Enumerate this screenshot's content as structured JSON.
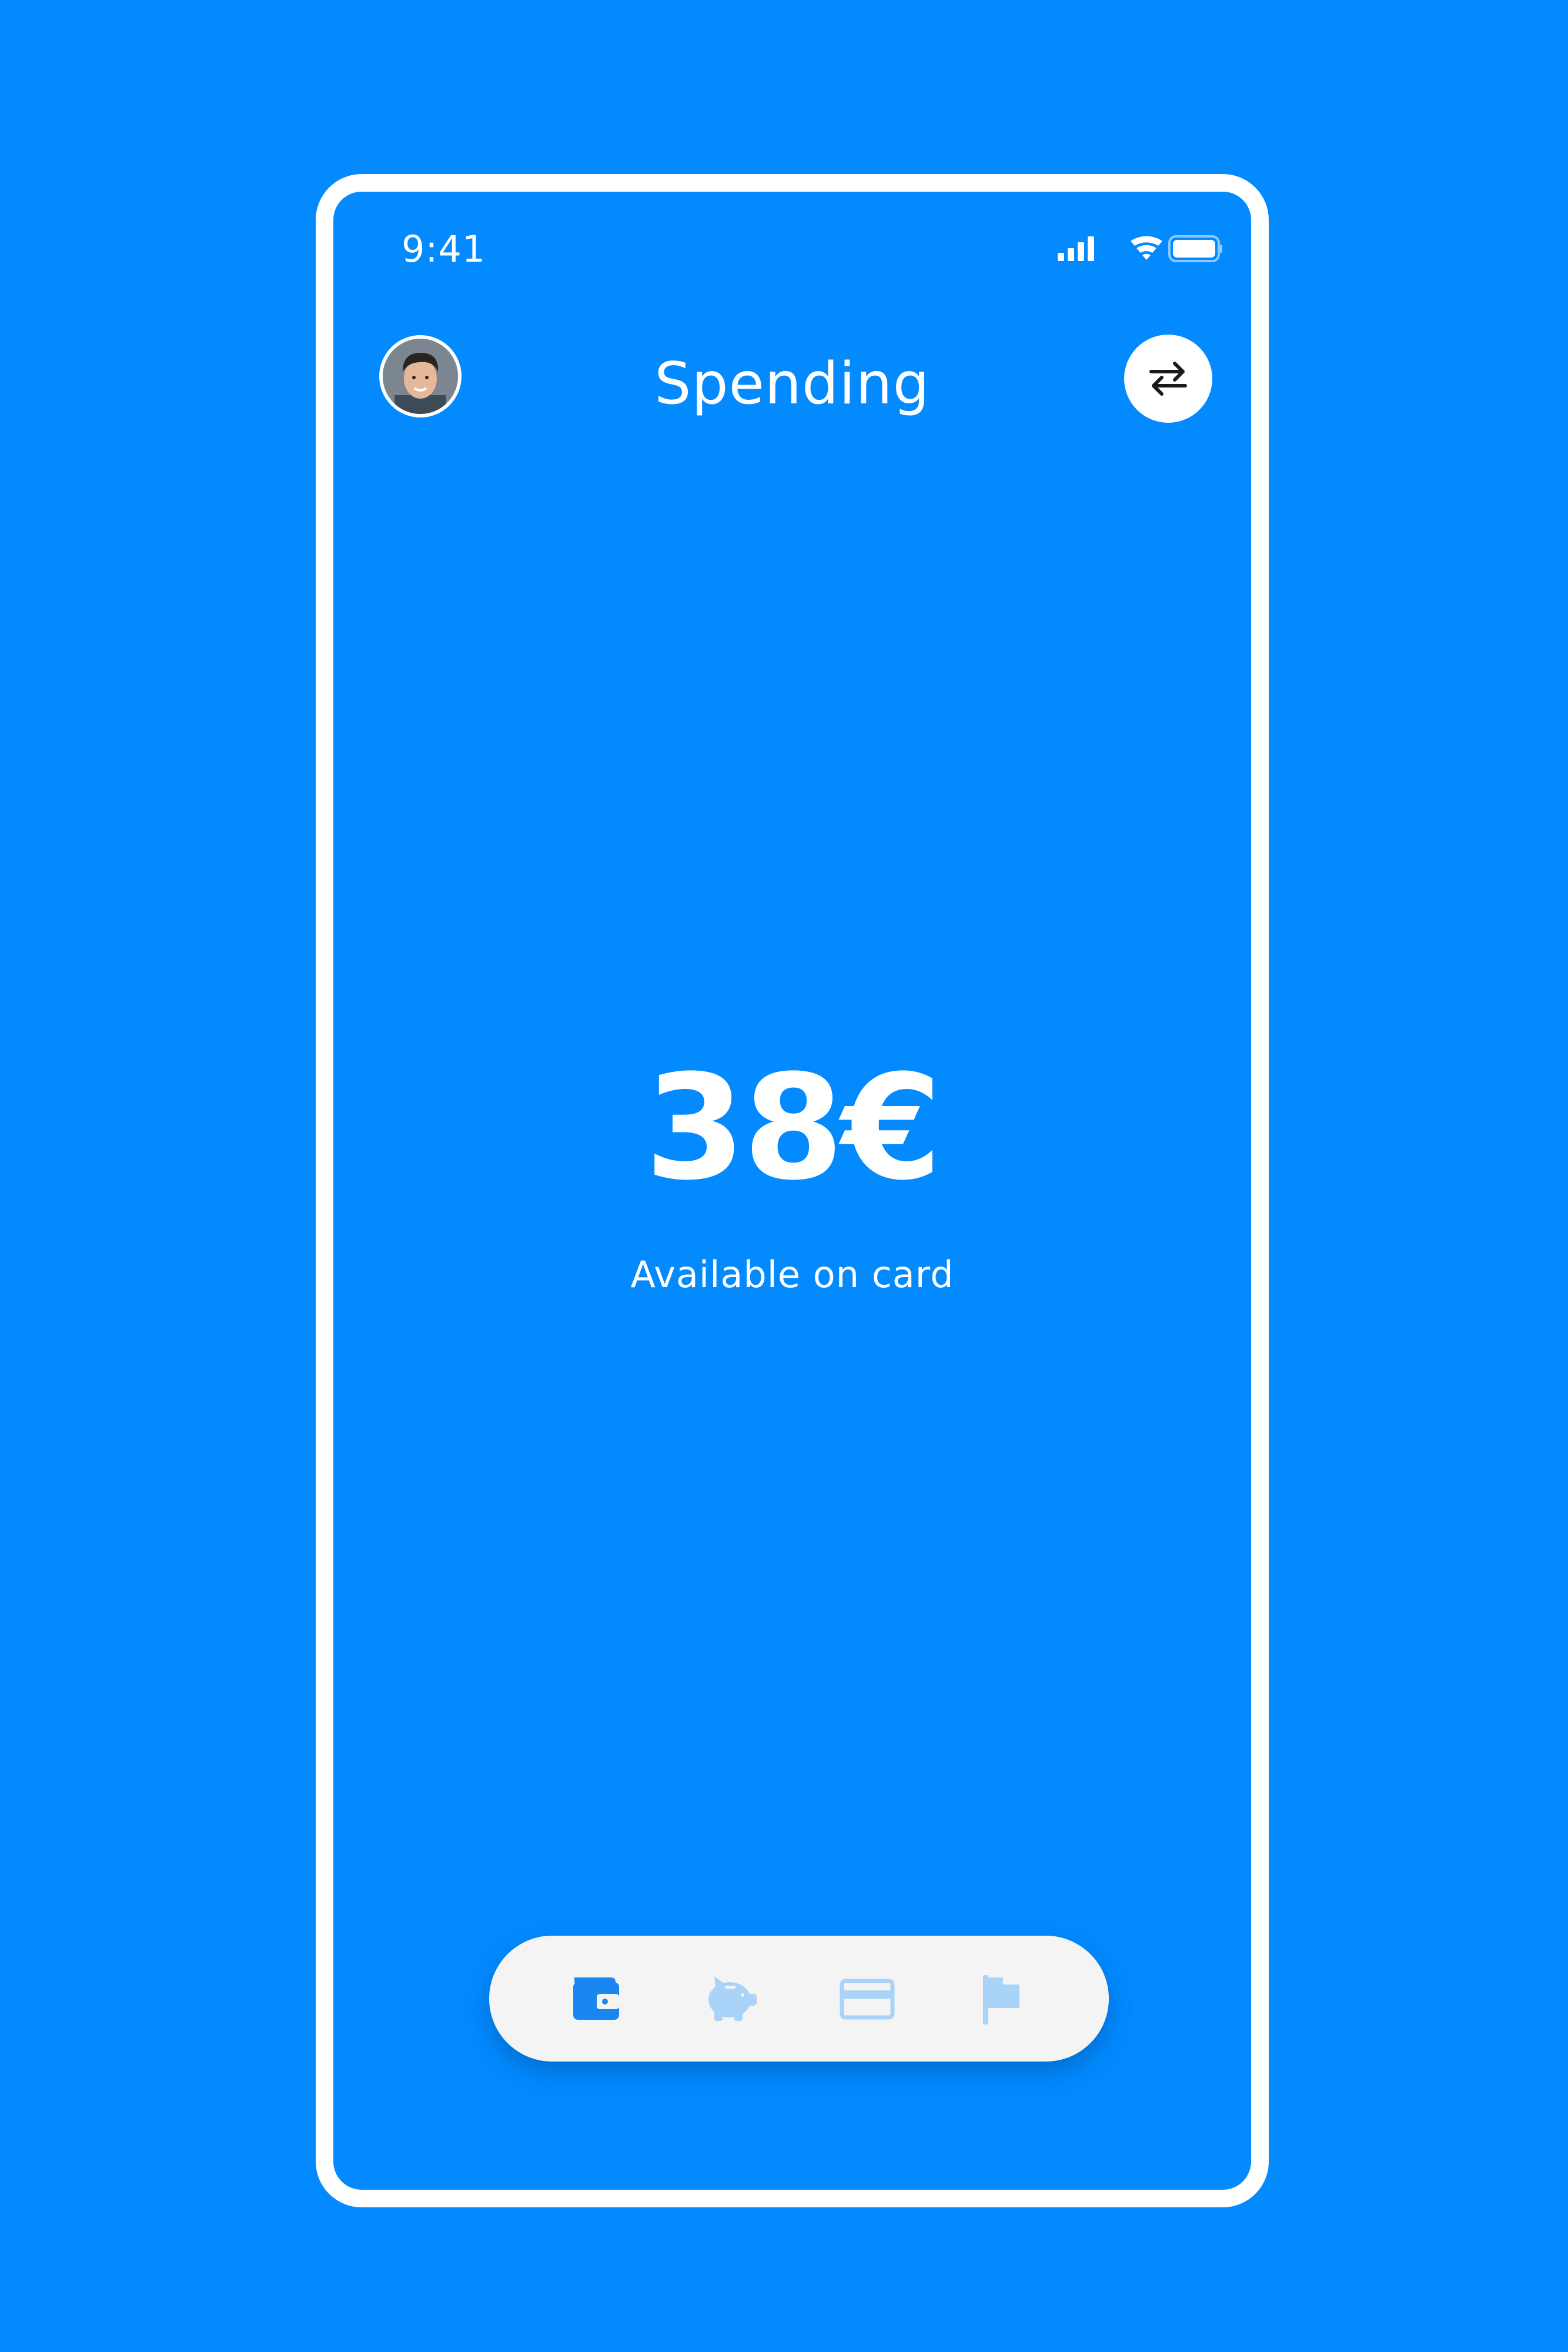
{
  "status_bar": {
    "time": "9:41",
    "icons": [
      "cellular-signal-icon",
      "wifi-icon",
      "battery-icon"
    ]
  },
  "header": {
    "title": "Spending",
    "avatar": "profile-avatar",
    "action_icon": "swap-arrows-icon"
  },
  "balance": {
    "amount": "38€",
    "label": "Available on card"
  },
  "tab_bar": {
    "tabs": [
      {
        "icon": "wallet-icon",
        "active": true
      },
      {
        "icon": "piggy-bank-icon",
        "active": false
      },
      {
        "icon": "credit-card-icon",
        "active": false
      },
      {
        "icon": "flag-icon",
        "active": false
      }
    ]
  },
  "colors": {
    "background": "#028AFE",
    "text": "#FFFFFF",
    "tab_bar": "#F4F4F4",
    "tab_active": "#1A86F0",
    "tab_inactive": "#A9D3F8"
  }
}
